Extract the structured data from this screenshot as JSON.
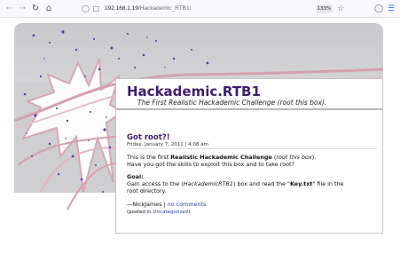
{
  "browser": {
    "url_host": "192.168.1.19",
    "url_path": "/Hackademic_RTB1/",
    "zoom": "133%"
  },
  "site": {
    "title": "Hackademic.RTB1",
    "tagline": "The First Realistic Hackademic Challenge (root this box)."
  },
  "post": {
    "title": "Got root?!",
    "date": "Friday, January 7, 2011 | 4:08 am",
    "intro_prefix": "This is the first ",
    "intro_bold": "Realistic Hackademic Challenge",
    "intro_mid": " (",
    "intro_italic": "root this box",
    "intro_suffix": ").",
    "question": "Have you got the skills to exploit this box and to take root?",
    "goal_heading": "Goal:",
    "goal_prefix": "Gain access to the (",
    "goal_italic": "HackademicRTB1",
    "goal_mid": ") box and read the \"",
    "goal_bold": "Key.txt",
    "goal_suffix": "\" file in the",
    "goal_line2": "root directory.",
    "author": "—NickJames",
    "separator": "|",
    "comments_link": "no comments",
    "posted_in": "(posted in",
    "category_link": "Uncategorized",
    "posted_close": ")"
  },
  "colors": {
    "accent": "#3d1e6b",
    "link": "#2a3f9e",
    "header_gray": "#cfcfd2"
  }
}
